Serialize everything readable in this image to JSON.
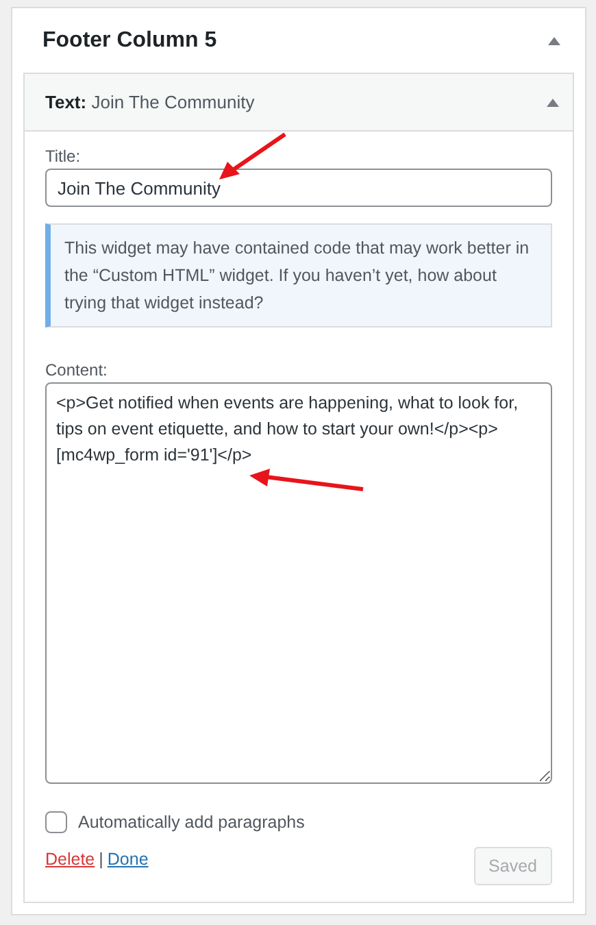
{
  "sidebar": {
    "title": "Footer Column 5",
    "expanded": true
  },
  "widget": {
    "type_label": "Text:",
    "title": "Join The Community",
    "expanded": true
  },
  "fields": {
    "title_label": "Title:",
    "title_value": "Join The Community",
    "notice": "This widget may have contained code that may work better in the “Custom HTML” widget. If you haven’t yet, how about trying that widget instead?",
    "content_label": "Content:",
    "content_value": "<p>Get notified when events are happening, what to look for, tips on event etiquette, and how to start your own!</p><p>[mc4wp_form id='91']</p>"
  },
  "auto_paragraphs": {
    "label": "Automatically add paragraphs",
    "checked": false
  },
  "actions": {
    "delete": "Delete",
    "separator": "|",
    "done": "Done"
  },
  "save_button": {
    "label": "Saved",
    "disabled": true
  }
}
